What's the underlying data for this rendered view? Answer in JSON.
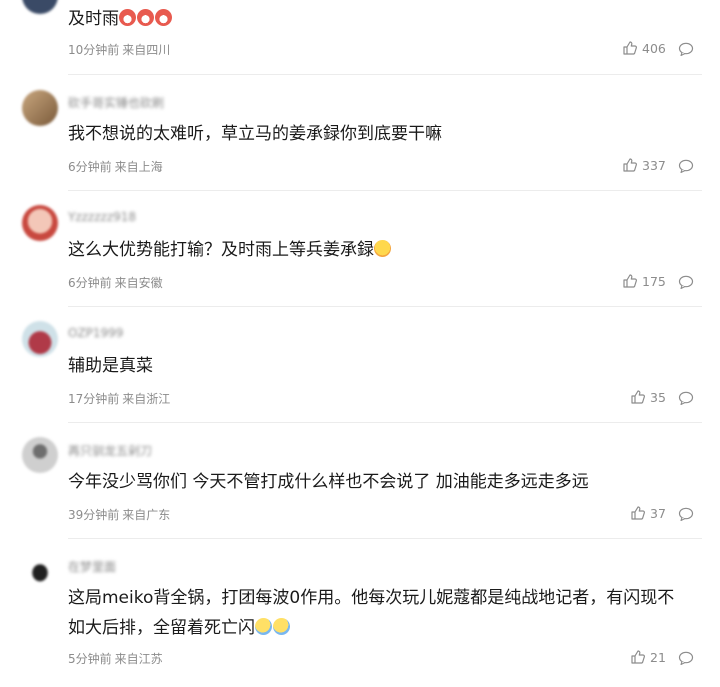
{
  "comments": [
    {
      "username": "",
      "text": "及时雨",
      "emoji": "laugh",
      "emoji_count": 3,
      "time": "10分钟前",
      "location": "来自四川",
      "likes": "406",
      "avatar_color": "#3a4a66"
    },
    {
      "username": "砍手哥实锤也砍刷",
      "text": "我不想说的太难听，草立马的姜承録你到底要干嘛",
      "emoji": "",
      "emoji_count": 0,
      "time": "6分钟前",
      "location": "来自上海",
      "likes": "337",
      "avatar_color": "#b08a62"
    },
    {
      "username": "Yzzzzzz918",
      "text": "这么大优势能打输？及时雨上等兵姜承録",
      "emoji": "shy",
      "emoji_count": 1,
      "time": "6分钟前",
      "location": "来自安徽",
      "likes": "175",
      "avatar_color": "#d98276"
    },
    {
      "username": "OZP1999",
      "text": "辅助是真菜",
      "emoji": "",
      "emoji_count": 0,
      "time": "17分钟前",
      "location": "来自浙江",
      "likes": "35",
      "avatar_color": "#9a3b4a"
    },
    {
      "username": "再只驯龙五剁刀",
      "text": "今年没少骂你们 今天不管打成什么样也不会说了 加油能走多远走多远",
      "emoji": "",
      "emoji_count": 0,
      "time": "39分钟前",
      "location": "来自广东",
      "likes": "37",
      "avatar_color": "#8d8d8d"
    },
    {
      "username": "在梦里面",
      "text": "这局meiko背全锅，打团每波0作用。他每次玩儿妮蔻都是纯战地记者，有闪现不如大后排，全留着死亡闪",
      "emoji": "cry",
      "emoji_count": 2,
      "time": "5分钟前",
      "location": "来自江苏",
      "likes": "21",
      "avatar_color": "#2a2a2a"
    }
  ],
  "icons": {
    "like": "thumbs-up-icon",
    "reply": "comment-bubble-icon"
  }
}
